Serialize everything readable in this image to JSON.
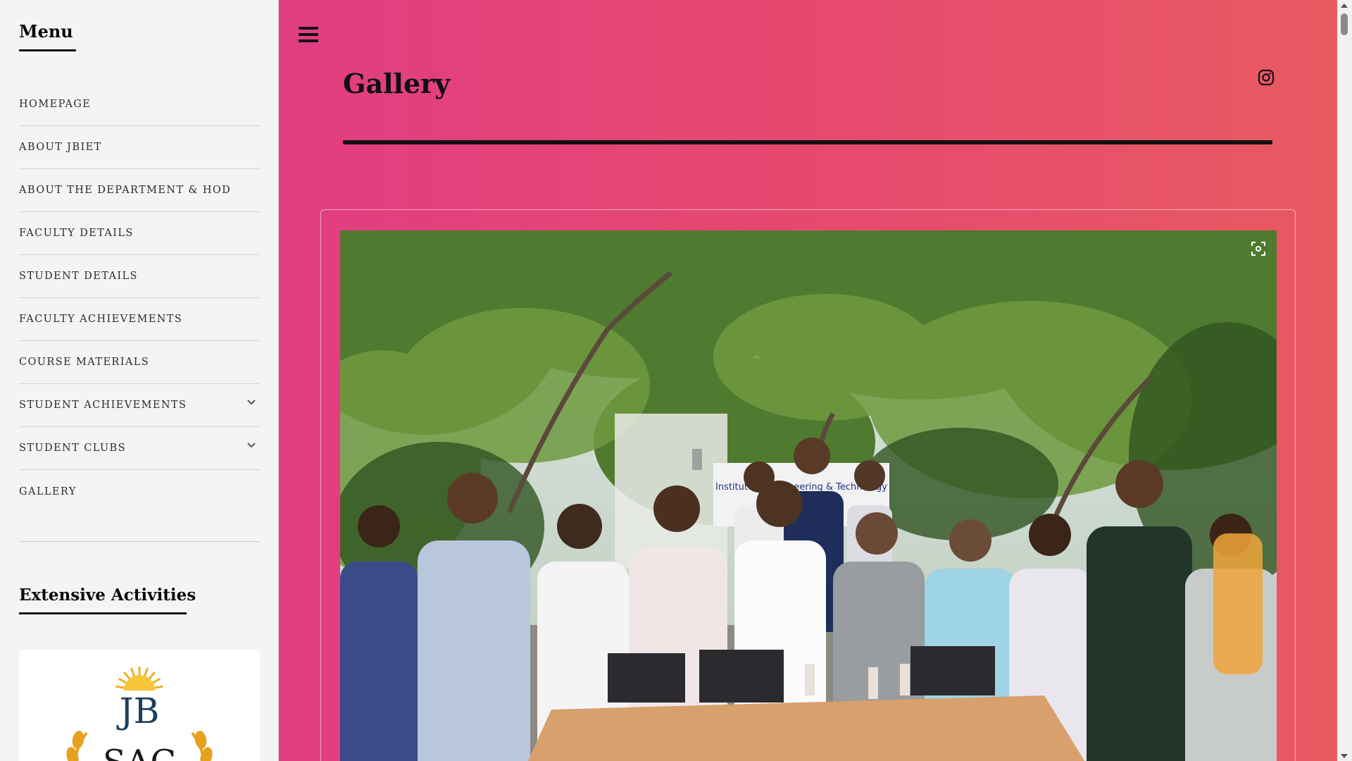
{
  "sidebar": {
    "menu_title": "Menu",
    "items": [
      {
        "label": "HOMEPAGE",
        "has_submenu": false
      },
      {
        "label": "ABOUT JBIET",
        "has_submenu": false
      },
      {
        "label": "ABOUT THE DEPARTMENT & HOD",
        "has_submenu": false
      },
      {
        "label": "FACULTY DETAILS",
        "has_submenu": false
      },
      {
        "label": "STUDENT DETAILS",
        "has_submenu": false
      },
      {
        "label": "FACULTY ACHIEVEMENTS",
        "has_submenu": false
      },
      {
        "label": "COURSE MATERIALS",
        "has_submenu": false
      },
      {
        "label": "STUDENT ACHIEVEMENTS",
        "has_submenu": true
      },
      {
        "label": "STUDENT CLUBS",
        "has_submenu": true
      },
      {
        "label": "GALLERY",
        "has_submenu": false
      }
    ],
    "extensive_title": "Extensive Activities",
    "logo": {
      "monogram": "JB",
      "subtext": "SAC"
    }
  },
  "main": {
    "menu_icon": "hamburger-icon",
    "page_title": "Gallery",
    "social_icon": "instagram-icon",
    "gallery": {
      "image_alt": "Group photo of students and faculty outdoors under trees with laptops on a table",
      "banner_text": "Institute of Engineering & Technology",
      "zoom_icon": "fullscreen-icon"
    }
  },
  "colors": {
    "gradient_start": "#e13d82",
    "gradient_end": "#e85a62",
    "sidebar_bg": "#f4f4f5",
    "text_dark": "#111111"
  }
}
